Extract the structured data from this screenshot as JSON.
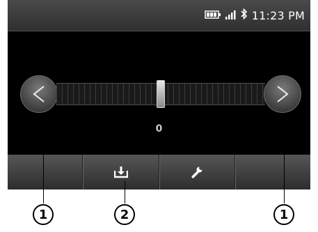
{
  "status_bar": {
    "time": "11:23 PM",
    "icons": [
      "battery-icon",
      "signal-icon",
      "bluetooth-icon"
    ]
  },
  "slider": {
    "value_text": "0",
    "position_fraction": 0.5,
    "decrease_glyph": "<",
    "increase_glyph": ">"
  },
  "toolbar": {
    "buttons": [
      "empty",
      "save-icon",
      "wrench-icon",
      "empty"
    ]
  },
  "callouts": [
    "1",
    "2",
    "1"
  ]
}
